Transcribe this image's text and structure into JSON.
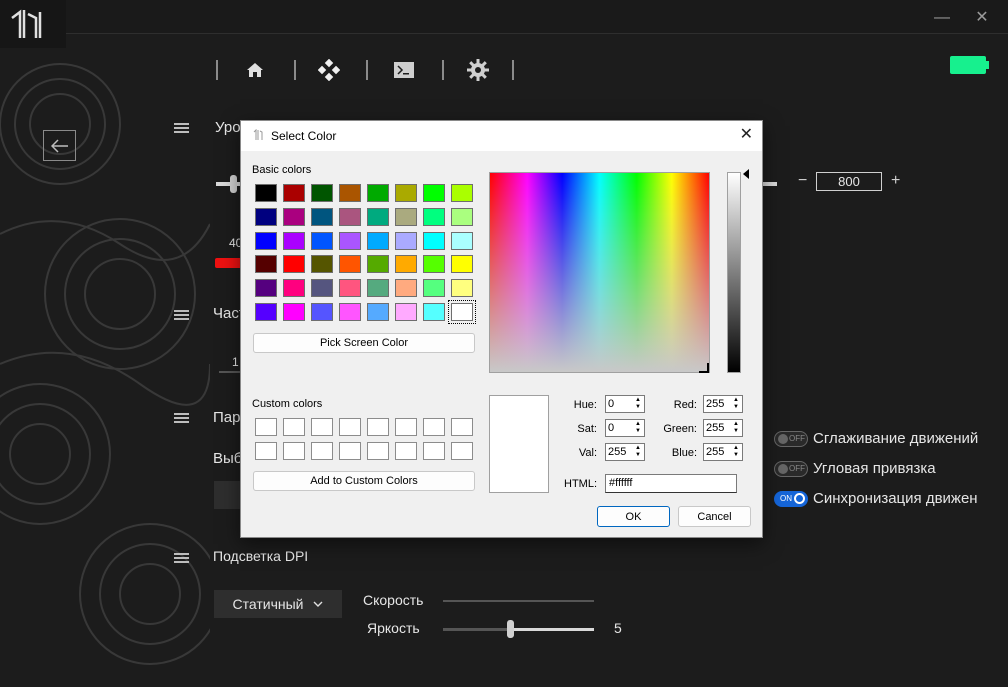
{
  "window": {
    "minimize_icon": "minimize-icon",
    "close_icon": "close-icon"
  },
  "nav": {
    "items": [
      {
        "icon": "home-icon"
      },
      {
        "icon": "diamond-icon"
      },
      {
        "icon": "terminal-icon"
      },
      {
        "icon": "gear-icon"
      }
    ]
  },
  "sections": {
    "level_title": "Уро",
    "dpi_value": "800",
    "dpi_minus": "−",
    "dpi_plus": "+",
    "left_value": "40",
    "freq_title": "Част",
    "freq_value": "1",
    "params_title": "Пара",
    "select_label": "Выб",
    "backlight_title": "Подсветка DPI",
    "mode_dropdown": "Статичный",
    "speed_label": "Скорость",
    "brightness_label": "Яркость",
    "brightness_value": "5"
  },
  "toggles": [
    {
      "state": "OFF",
      "label": "Сглаживание движений"
    },
    {
      "state": "OFF",
      "label": "Угловая привязка"
    },
    {
      "state": "ON",
      "label": "Синхронизация движен"
    }
  ],
  "dialog": {
    "title": "Select Color",
    "basic_colors_label": "Basic colors",
    "pick_screen_label": "Pick Screen Color",
    "custom_colors_label": "Custom colors",
    "add_custom_label": "Add to Custom Colors",
    "ok_label": "OK",
    "cancel_label": "Cancel",
    "basic_colors": [
      [
        "#000000",
        "#aa0000",
        "#005500",
        "#aa5500",
        "#00aa00",
        "#aaaa00",
        "#00ff00",
        "#aaff00"
      ],
      [
        "#00007f",
        "#aa007f",
        "#00557f",
        "#aa557f",
        "#00aa7f",
        "#aaaa7f",
        "#00ff7f",
        "#aaff7f"
      ],
      [
        "#0000ff",
        "#aa00ff",
        "#0055ff",
        "#aa55ff",
        "#00aaff",
        "#aaaaff",
        "#00ffff",
        "#aaffff"
      ],
      [
        "#550000",
        "#ff0000",
        "#555500",
        "#ff5500",
        "#55aa00",
        "#ffaa00",
        "#55ff00",
        "#ffff00"
      ],
      [
        "#55007f",
        "#ff007f",
        "#55557f",
        "#ff557f",
        "#55aa7f",
        "#ffaa7f",
        "#55ff7f",
        "#ffff7f"
      ],
      [
        "#5500ff",
        "#ff00ff",
        "#5555ff",
        "#ff55ff",
        "#55aaff",
        "#ffaaff",
        "#55ffff",
        "#ffffff"
      ]
    ],
    "fields": {
      "hue_label": "Hue:",
      "hue": "0",
      "sat_label": "Sat:",
      "sat": "0",
      "val_label": "Val:",
      "val": "255",
      "red_label": "Red:",
      "red": "255",
      "green_label": "Green:",
      "green": "255",
      "blue_label": "Blue:",
      "blue": "255",
      "html_label": "HTML:",
      "html": "#ffffff"
    }
  }
}
